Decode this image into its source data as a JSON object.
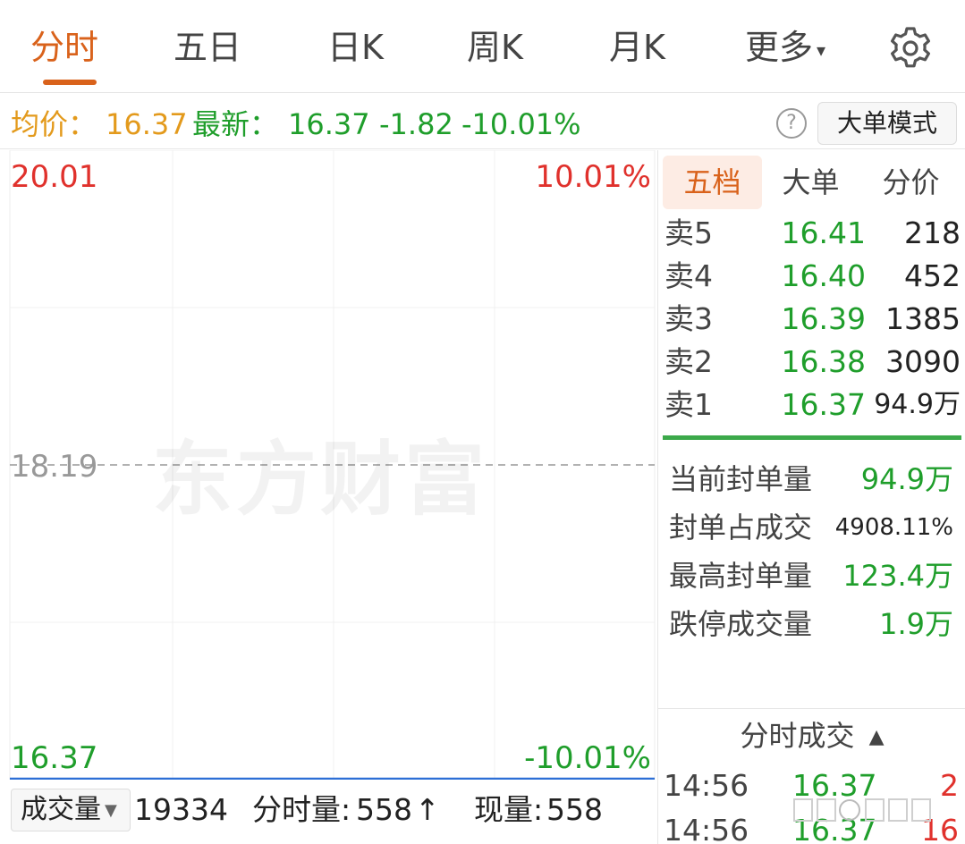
{
  "tabs": [
    {
      "label": "分时",
      "active": true
    },
    {
      "label": "五日"
    },
    {
      "label": "日K"
    },
    {
      "label": "周K"
    },
    {
      "label": "月K"
    },
    {
      "label": "更多"
    }
  ],
  "icons": {
    "more_caret": "▾",
    "help": "?",
    "gear": "gear-icon",
    "select_caret": "▼",
    "up_arrow": "↑",
    "sort_caret": "▲"
  },
  "info": {
    "avg_label": "均价：",
    "avg_value": "16.37",
    "latest_label": "最新：",
    "latest_value": "16.37",
    "change": "-1.82",
    "change_pct": "-10.01%",
    "big_order_button": "大单模式"
  },
  "chart": {
    "y_top": "20.01",
    "y_top_pct": "10.01%",
    "y_mid": "18.19",
    "y_bottom": "16.37",
    "y_bottom_pct": "-10.01%",
    "watermark": "东方财富"
  },
  "chart_data": {
    "type": "line",
    "ylim": [
      16.37,
      20.01
    ],
    "reference_price": 18.19,
    "series": [
      {
        "values": [
          16.37,
          16.37
        ]
      }
    ]
  },
  "volume": {
    "select_label": "成交量",
    "total": "19334",
    "minute_label": "分时量:",
    "minute_value": "558",
    "current_label": "现量:",
    "current_value": "558"
  },
  "right_tabs": [
    "五档",
    "大单",
    "分价"
  ],
  "asks": [
    {
      "label": "卖5",
      "price": "16.41",
      "volume": "218"
    },
    {
      "label": "卖4",
      "price": "16.40",
      "volume": "452"
    },
    {
      "label": "卖3",
      "price": "16.39",
      "volume": "1385"
    },
    {
      "label": "卖2",
      "price": "16.38",
      "volume": "3090"
    },
    {
      "label": "卖1",
      "price": "16.37",
      "volume": "94.9万"
    }
  ],
  "seal": [
    {
      "label": "当前封单量",
      "value": "94.9万"
    },
    {
      "label": "封单占成交",
      "value": "4908.11%"
    },
    {
      "label": "最高封单量",
      "value": "123.4万"
    },
    {
      "label": "跌停成交量",
      "value": "1.9万"
    }
  ],
  "ticks": {
    "title": "分时成交",
    "rows": [
      {
        "time": "14:56",
        "price": "16.37",
        "volume": "2"
      },
      {
        "time": "14:56",
        "price": "16.37",
        "volume": "16"
      }
    ]
  },
  "colors": {
    "accent": "#d9621b",
    "up": "#e0312c",
    "down": "#1f9e2b",
    "avg": "#e39a1c",
    "price_line": "#2d6fd6"
  }
}
